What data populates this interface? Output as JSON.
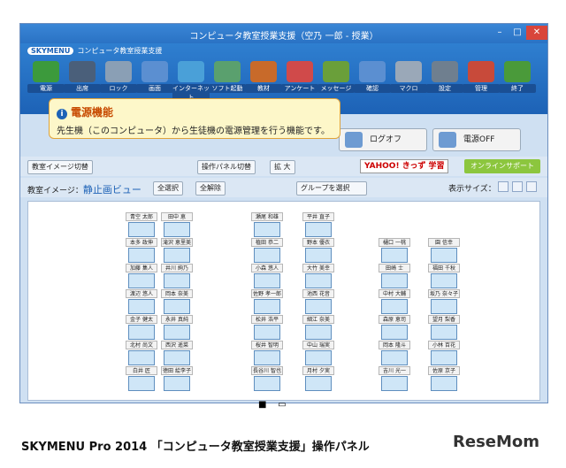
{
  "window": {
    "title": "コンピュータ教室授業支援（空乃 一郎 - 授業）",
    "minimize": "–",
    "maximize": "□",
    "close": "✕"
  },
  "brand": {
    "logo": "SKYMENU",
    "subtitle": "コンピュータ教室授業支援"
  },
  "toolbar": [
    {
      "label": "電源",
      "color": "#3c9a3c"
    },
    {
      "label": "出席",
      "color": "#4a5f7a"
    },
    {
      "label": "ロック",
      "color": "#8a9fb5"
    },
    {
      "label": "画面",
      "color": "#5b8fd1"
    },
    {
      "label": "インターネット",
      "color": "#4aa0d8"
    },
    {
      "label": "ソフト起動",
      "color": "#5aa06e"
    },
    {
      "label": "教材",
      "color": "#c86a2a"
    },
    {
      "label": "アンケート",
      "color": "#d04a4a"
    },
    {
      "label": "メッセージ",
      "color": "#6a9f3a"
    },
    {
      "label": "確認",
      "color": "#5b8fd1"
    },
    {
      "label": "マクロ",
      "color": "#9aa8b8"
    },
    {
      "label": "設定",
      "color": "#6f7f8f"
    },
    {
      "label": "管理",
      "color": "#c84a3a"
    },
    {
      "label": "終了",
      "color": "#4a9a3a"
    }
  ],
  "tooltip": {
    "heading": "電源機能",
    "body": "先生機（このコンピュータ）から生徒機の電源管理を行う機能です。"
  },
  "actions": {
    "logoff": "ログオフ",
    "power_off": "電源OFF"
  },
  "strip": {
    "image_switch": "教室イメージ切替",
    "panel_switch": "操作パネル切替",
    "zoom": "拡 大",
    "yahoo": "YAHOO! きっず 学習",
    "online_support": "オンラインサポート"
  },
  "view": {
    "label": "教室イメージ：",
    "mode": "静止画ビュー",
    "select_all": "全選択",
    "deselect_all": "全解除",
    "group_select": "グループを選択",
    "size_label": "表示サイズ："
  },
  "seats": [
    {
      "name": "青空 太郎"
    },
    {
      "name": "田中 恵"
    },
    {
      "name": "瀬尾 和雄"
    },
    {
      "name": "平井 直子"
    },
    {
      "name": "本多 政伸"
    },
    {
      "name": "滝沢 恵里美"
    },
    {
      "name": "植田 恭二"
    },
    {
      "name": "野本 優衣"
    },
    {
      "name": "樋口 一桃"
    },
    {
      "name": "園 信幸"
    },
    {
      "name": "加藤 集人"
    },
    {
      "name": "井川 絢乃"
    },
    {
      "name": "小森 悠人"
    },
    {
      "name": "大竹 美幸"
    },
    {
      "name": "田崎 士"
    },
    {
      "name": "福田 千秋"
    },
    {
      "name": "渡辺 悠人"
    },
    {
      "name": "岡本 奈美"
    },
    {
      "name": "佐野 孝一郎"
    },
    {
      "name": "池西 花音"
    },
    {
      "name": "中村 大輔"
    },
    {
      "name": "坂乃 奈々子"
    },
    {
      "name": "金子 健太"
    },
    {
      "name": "永井 真純"
    },
    {
      "name": "松井 浩平"
    },
    {
      "name": "細江 奈美"
    },
    {
      "name": "森原 恵司"
    },
    {
      "name": "望月 梨香"
    },
    {
      "name": "北村 尚文"
    },
    {
      "name": "西沢 遥菜"
    },
    {
      "name": "桜井 智明"
    },
    {
      "name": "中山 瑞実"
    },
    {
      "name": "岡本 隆斗"
    },
    {
      "name": "小林 百花"
    },
    {
      "name": "白井 匠"
    },
    {
      "name": "徳田 絵李子"
    },
    {
      "name": "長谷川 智也"
    },
    {
      "name": "月村 夕実"
    },
    {
      "name": "吉川 光一"
    },
    {
      "name": "佐原 京子"
    }
  ],
  "caption": "SKYMENU Pro 2014 「コンピュータ教室授業支援」操作パネル",
  "watermark": "ReseMom"
}
